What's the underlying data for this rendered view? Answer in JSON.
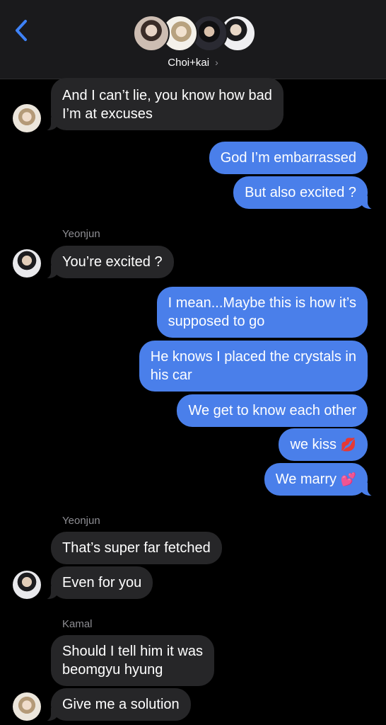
{
  "header": {
    "back_icon": "chevron-left-icon",
    "group_name": "Choi+kai",
    "chevron": "›",
    "accent_color": "#3e82f7"
  },
  "colors": {
    "outgoing_bubble": "#4a7fea",
    "incoming_bubble": "#262628",
    "sender_label": "#8e8e93"
  },
  "messages": [
    {
      "direction": "in",
      "text_lines": [
        "And I can’t lie, you know how bad",
        "I’m at excuses"
      ]
    },
    {
      "direction": "out",
      "text": "God I’m embarrassed"
    },
    {
      "direction": "out",
      "text": "But also excited ?"
    },
    {
      "direction": "in",
      "sender": "Yeonjun",
      "text": "You’re excited ?"
    },
    {
      "direction": "out",
      "text_lines": [
        "I mean...Maybe this is how it’s",
        "supposed to go"
      ]
    },
    {
      "direction": "out",
      "text_lines": [
        "He knows I placed the crystals in",
        "his car"
      ]
    },
    {
      "direction": "out",
      "text": "We get to know each other"
    },
    {
      "direction": "out",
      "text": "we kiss",
      "emoji": "💋"
    },
    {
      "direction": "out",
      "text": "We marry",
      "emoji": "💕"
    },
    {
      "direction": "in",
      "sender": "Yeonjun",
      "text": "That’s super far fetched"
    },
    {
      "direction": "in",
      "text": "Even for you"
    },
    {
      "direction": "in",
      "sender": "Kamal",
      "text_lines": [
        "Should I tell him it was",
        "beomgyu hyung"
      ]
    },
    {
      "direction": "in",
      "text": "Give me a solution"
    }
  ]
}
